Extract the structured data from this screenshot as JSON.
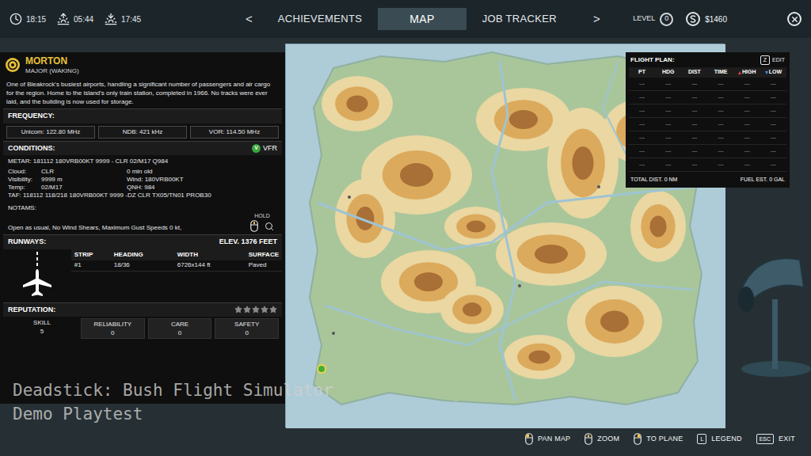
{
  "top_bar": {
    "clock": [
      {
        "kind": "clock",
        "text": "18:15"
      },
      {
        "kind": "sunrise",
        "text": "05:44"
      },
      {
        "kind": "sunset",
        "text": "17:45"
      }
    ],
    "prev": "<",
    "next": ">",
    "tabs": [
      {
        "label": "ACHIEVEMENTS",
        "selected": false
      },
      {
        "label": "MAP",
        "selected": true
      },
      {
        "label": "JOB TRACKER",
        "selected": false
      }
    ],
    "level": {
      "label": "LEVEL",
      "value": "0"
    },
    "money": "$1460"
  },
  "airport": {
    "name": "MORTON",
    "type": "MAJOR (WAKING)",
    "description": "One of Bleakrock's busiest airports, handling a significant number of passengers and air cargo for the region. Home to the island's only train station, completed in 1966. No tracks were ever laid, and the building is now used for storage."
  },
  "frequency": {
    "heading": "FREQUENCY:",
    "items": [
      "Unicom: 122.80 MHz",
      "NDB: 421 kHz",
      "VOR: 114.50 MHz"
    ]
  },
  "conditions": {
    "heading": "CONDITIONS:",
    "rule_badge": "V",
    "rule": "VFR",
    "metar": "METAR: 181112 180VRB00KT 9999 - CLR 02/M17 Q984",
    "details": [
      {
        "label": "Cloud:",
        "value": "CLR",
        "right": "0 min old"
      },
      {
        "label": "Visibility:",
        "value": "9999 m",
        "right": "Wind: 180VRB00KT"
      },
      {
        "label": "Temp:",
        "value": "02/M17",
        "right": "QNH: 984"
      }
    ],
    "taf": "TAF: 118112 118/218 180VRB00KT 9999 -DZ CLR TX05/TN01 PROB30",
    "notams_heading": "NOTAMS:",
    "notams": "Open as usual, No Wind Shears, Maximum Gust Speeds 0 kt,",
    "hold": "HOLD",
    "hold_button": "middle"
  },
  "runways": {
    "heading": "RUNWAYS:",
    "elevation": "ELEV. 1376 FEET",
    "columns": [
      "STRIP",
      "HEADING",
      "WIDTH",
      "SURFACE"
    ],
    "rows": [
      [
        "#1",
        "18/36",
        "6726x144 ft",
        "Paved"
      ]
    ]
  },
  "reputation": {
    "heading": "REPUTATION:",
    "stars": 0,
    "skill_label": "SKILL",
    "skill": "5",
    "stats": [
      {
        "label": "RELIABILITY",
        "value": "0"
      },
      {
        "label": "CARE",
        "value": "0"
      },
      {
        "label": "SAFETY",
        "value": "0"
      }
    ]
  },
  "flight_plan": {
    "title": "FLIGHT PLAN:",
    "edit_key": "Z",
    "edit": "EDIT",
    "columns": [
      "PT",
      "HDG",
      "DIST",
      "TIME",
      "HIGH",
      "LOW"
    ],
    "rows": [
      [
        "---",
        "---",
        "---",
        "---",
        "---",
        "---"
      ],
      [
        "---",
        "---",
        "---",
        "---",
        "---",
        "---"
      ],
      [
        "---",
        "---",
        "---",
        "---",
        "---",
        "---"
      ],
      [
        "---",
        "---",
        "---",
        "---",
        "---",
        "---"
      ],
      [
        "---",
        "---",
        "---",
        "---",
        "---",
        "---"
      ],
      [
        "---",
        "---",
        "---",
        "---",
        "---",
        "---"
      ],
      [
        "---",
        "---",
        "---",
        "---",
        "---",
        "---"
      ]
    ],
    "total": "TOTAL DIST. 0 NM",
    "fuel": "FUEL EST. 0 GAL"
  },
  "controls": [
    {
      "kind": "mouse",
      "button": "left",
      "label": "PAN MAP"
    },
    {
      "kind": "mouse",
      "button": "middle",
      "label": "ZOOM"
    },
    {
      "kind": "mouse",
      "button": "right",
      "label": "TO PLANE"
    },
    {
      "kind": "key",
      "key": "L",
      "label": "LEGEND"
    },
    {
      "kind": "key",
      "key": "ESC",
      "label": "EXIT"
    }
  ],
  "watermark": [
    "Deadstick: Bush Flight Simulator",
    "Demo Playtest"
  ]
}
